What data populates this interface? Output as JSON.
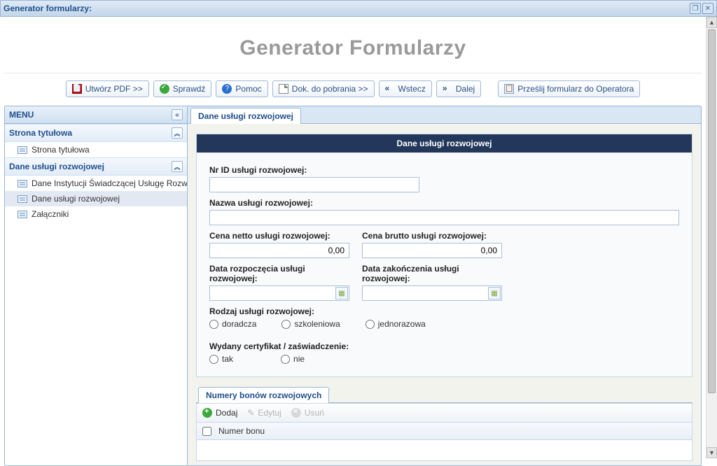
{
  "window": {
    "title": "Generator formularzy:"
  },
  "page_title": "Generator Formularzy",
  "toolbar": {
    "pdf": "Utwórz PDF >>",
    "check": "Sprawdź",
    "help": "Pomoc",
    "download": "Dok. do pobrania >>",
    "back": "Wstecz",
    "next": "Dalej",
    "send": "Prześlij formularz do Operatora"
  },
  "sidebar": {
    "title": "MENU",
    "sections": [
      {
        "title": "Strona tytułowa",
        "items": [
          {
            "label": "Strona tytułowa"
          }
        ]
      },
      {
        "title": "Dane usługi rozwojowej",
        "items": [
          {
            "label": "Dane Instytucji Świadczącej Usługę Rozwo"
          },
          {
            "label": "Dane usługi rozwojowej"
          },
          {
            "label": "Załączniki"
          }
        ]
      }
    ],
    "selected": "Dane usługi rozwojowej"
  },
  "main": {
    "tab": "Dane usługi rozwojowej",
    "panel_title": "Dane usługi rozwojowej",
    "fields": {
      "id_label": "Nr ID usługi rozwojowej:",
      "id_value": "",
      "name_label": "Nazwa usługi rozwojowej:",
      "name_value": "",
      "price_net_label": "Cena netto usługi rozwojowej:",
      "price_net_value": "0,00",
      "price_gross_label": "Cena brutto usługi rozwojowej:",
      "price_gross_value": "0,00",
      "date_start_label": "Data rozpoczęcia usługi rozwojowej:",
      "date_start_value": "",
      "date_end_label": "Data zakończenia usługi rozwojowej:",
      "date_end_value": "",
      "kind_label": "Rodzaj usługi rozwojowej:",
      "kind_options": {
        "opt1": "doradcza",
        "opt2": "szkoleniowa",
        "opt3": "jednorazowa"
      },
      "cert_label": "Wydany certyfikat / zaświadczenie:",
      "cert_options": {
        "yes": "tak",
        "no": "nie"
      }
    },
    "sub": {
      "tab": "Numery bonów rozwojowych",
      "toolbar": {
        "add": "Dodaj",
        "edit": "Edytuj",
        "del": "Usuń"
      },
      "columns": {
        "col1": "Numer bonu"
      }
    }
  }
}
